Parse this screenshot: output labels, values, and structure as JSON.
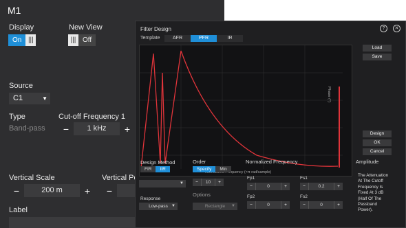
{
  "m1": {
    "title": "M1",
    "display_label": "Display",
    "display_on": "On",
    "newview_label": "New View",
    "newview_off": "Off",
    "source_label": "Source",
    "source_value": "C1",
    "type_label": "Type",
    "type_value": "Band-pass",
    "cutoff_label": "Cut-off Frequency 1",
    "cutoff_value": "1 kHz",
    "vscale_label": "Vertical Scale",
    "vscale_value": "200 m",
    "vpos_label": "Vertical Po",
    "label_label": "Label"
  },
  "dialog": {
    "title": "Filter Design",
    "template_label": "Template",
    "tabs": [
      "AFR",
      "PFR",
      "IR"
    ],
    "active_tab": "PFR",
    "buttons": {
      "load": "Load",
      "save": "Save",
      "design": "Design",
      "ok": "OK",
      "cancel": "Cancel"
    },
    "design_method_label": "Design Method",
    "fir": "FIR",
    "iir": "IIR",
    "order_label": "Order",
    "specify": "Specify",
    "min": "Min",
    "order_value": "10",
    "response_label": "Response",
    "response_value": "Low-pass",
    "options_label": "Options",
    "options_value": "Rectangle",
    "normfreq_label": "Normalized Frequency",
    "fp1_label": "Fp1",
    "fp1_value": "0",
    "fs1_label": "Fs1",
    "fs1_value": "0.2",
    "fp2_label": "Fp2",
    "fp2_value": "0",
    "fs2_label": "Fs2",
    "fs2_value": "0",
    "amplitude_label": "Amplitude",
    "amplitude_note": "The Attenuation At The Cutoff Frequency Is Fixed At 3 dB (Half Of The Passband Power).",
    "chart_xlabel": "Normalized Frequency (×π rad/sample)",
    "chart_ylabel": "Phase (°)"
  },
  "colors": {
    "accent": "#1f8fd8",
    "curve": "#e0343a",
    "panel": "#2e2e30",
    "dialog": "#1f1f21"
  }
}
